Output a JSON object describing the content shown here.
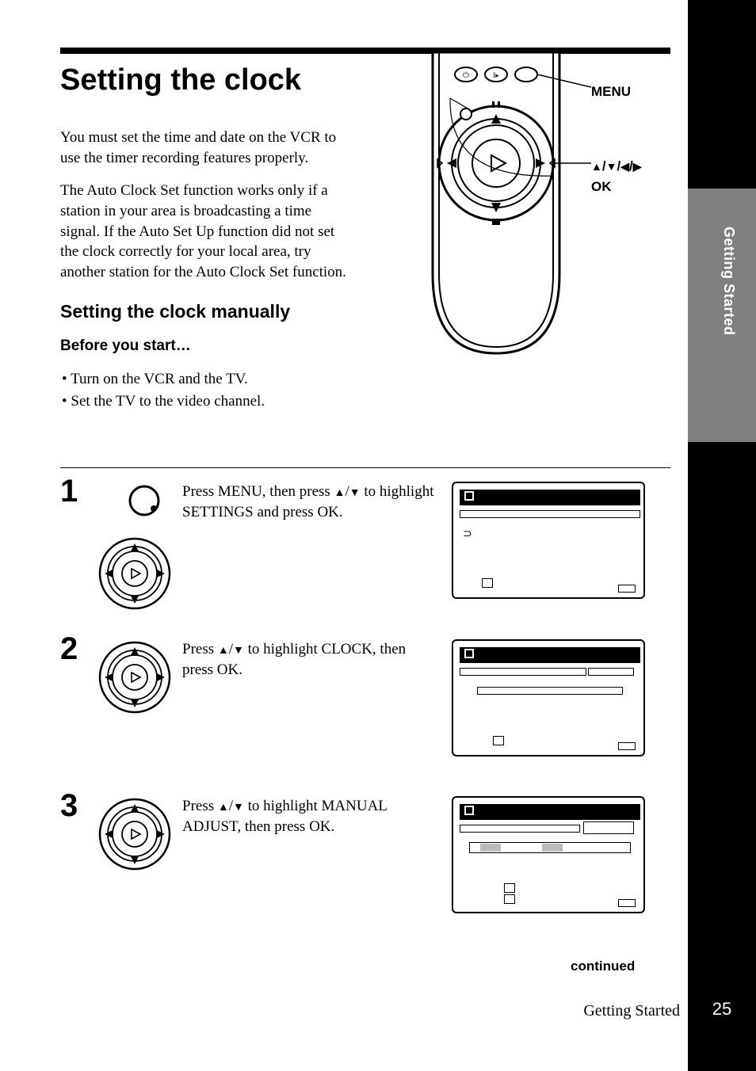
{
  "page": {
    "title": "Setting the clock",
    "intro_p1": "You must set the time and date on the VCR to use the timer recording features properly.",
    "intro_p2": "The Auto Clock Set function works only if a station in your area is broadcasting a time signal.  If the Auto Set Up function did not set the clock correctly for your local area, try another station for the Auto Clock Set function.",
    "h2": "Setting the clock manually",
    "before_heading": "Before you start…",
    "bullets": [
      "Turn on the VCR and the TV.",
      "Set the TV to the video channel."
    ],
    "continued": "continued",
    "footer_section": "Getting Started",
    "page_number": "25",
    "side_tab": "Getting Started"
  },
  "remote_labels": {
    "menu": "MENU",
    "arrows": "↑/↓/←/→",
    "ok": "OK"
  },
  "steps": [
    {
      "num": "1",
      "text_pre": "Press MENU, then press ",
      "text_post": " to highlight SETTINGS and press OK."
    },
    {
      "num": "2",
      "text_pre": "Press ",
      "text_post": " to highlight CLOCK, then press OK."
    },
    {
      "num": "3",
      "text_pre": "Press ",
      "text_post": " to highlight MANUAL ADJUST, then press OK."
    }
  ]
}
